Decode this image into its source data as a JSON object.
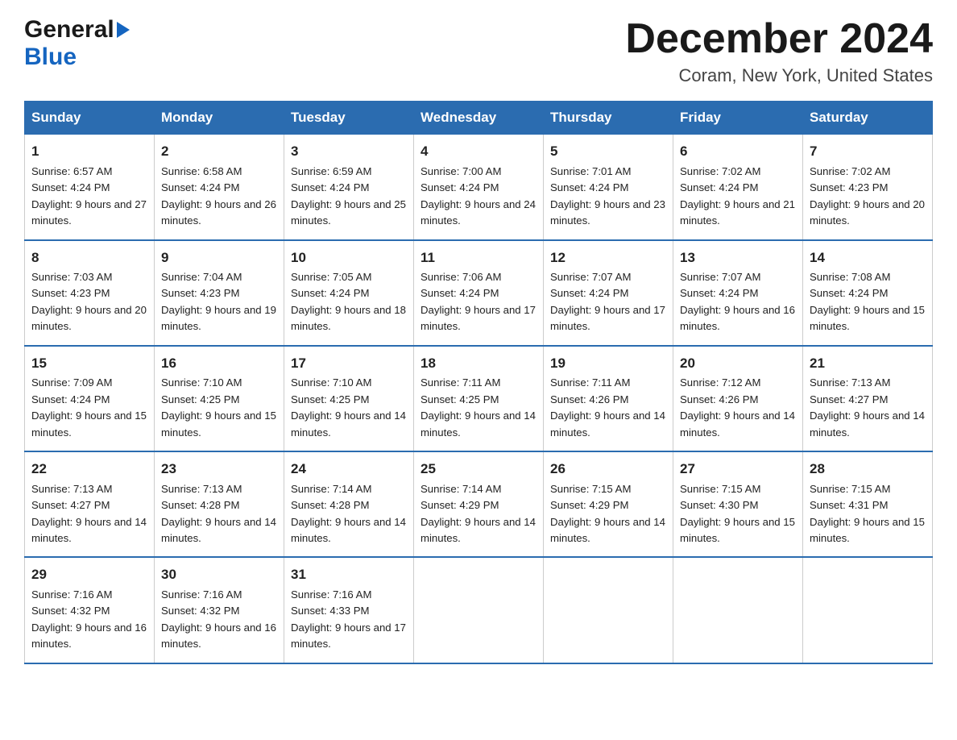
{
  "header": {
    "logo_general": "General",
    "logo_blue": "Blue",
    "title": "December 2024",
    "subtitle": "Coram, New York, United States"
  },
  "days_of_week": [
    "Sunday",
    "Monday",
    "Tuesday",
    "Wednesday",
    "Thursday",
    "Friday",
    "Saturday"
  ],
  "weeks": [
    [
      {
        "day": "1",
        "sunrise": "6:57 AM",
        "sunset": "4:24 PM",
        "daylight": "9 hours and 27 minutes."
      },
      {
        "day": "2",
        "sunrise": "6:58 AM",
        "sunset": "4:24 PM",
        "daylight": "9 hours and 26 minutes."
      },
      {
        "day": "3",
        "sunrise": "6:59 AM",
        "sunset": "4:24 PM",
        "daylight": "9 hours and 25 minutes."
      },
      {
        "day": "4",
        "sunrise": "7:00 AM",
        "sunset": "4:24 PM",
        "daylight": "9 hours and 24 minutes."
      },
      {
        "day": "5",
        "sunrise": "7:01 AM",
        "sunset": "4:24 PM",
        "daylight": "9 hours and 23 minutes."
      },
      {
        "day": "6",
        "sunrise": "7:02 AM",
        "sunset": "4:24 PM",
        "daylight": "9 hours and 21 minutes."
      },
      {
        "day": "7",
        "sunrise": "7:02 AM",
        "sunset": "4:23 PM",
        "daylight": "9 hours and 20 minutes."
      }
    ],
    [
      {
        "day": "8",
        "sunrise": "7:03 AM",
        "sunset": "4:23 PM",
        "daylight": "9 hours and 20 minutes."
      },
      {
        "day": "9",
        "sunrise": "7:04 AM",
        "sunset": "4:23 PM",
        "daylight": "9 hours and 19 minutes."
      },
      {
        "day": "10",
        "sunrise": "7:05 AM",
        "sunset": "4:24 PM",
        "daylight": "9 hours and 18 minutes."
      },
      {
        "day": "11",
        "sunrise": "7:06 AM",
        "sunset": "4:24 PM",
        "daylight": "9 hours and 17 minutes."
      },
      {
        "day": "12",
        "sunrise": "7:07 AM",
        "sunset": "4:24 PM",
        "daylight": "9 hours and 17 minutes."
      },
      {
        "day": "13",
        "sunrise": "7:07 AM",
        "sunset": "4:24 PM",
        "daylight": "9 hours and 16 minutes."
      },
      {
        "day": "14",
        "sunrise": "7:08 AM",
        "sunset": "4:24 PM",
        "daylight": "9 hours and 15 minutes."
      }
    ],
    [
      {
        "day": "15",
        "sunrise": "7:09 AM",
        "sunset": "4:24 PM",
        "daylight": "9 hours and 15 minutes."
      },
      {
        "day": "16",
        "sunrise": "7:10 AM",
        "sunset": "4:25 PM",
        "daylight": "9 hours and 15 minutes."
      },
      {
        "day": "17",
        "sunrise": "7:10 AM",
        "sunset": "4:25 PM",
        "daylight": "9 hours and 14 minutes."
      },
      {
        "day": "18",
        "sunrise": "7:11 AM",
        "sunset": "4:25 PM",
        "daylight": "9 hours and 14 minutes."
      },
      {
        "day": "19",
        "sunrise": "7:11 AM",
        "sunset": "4:26 PM",
        "daylight": "9 hours and 14 minutes."
      },
      {
        "day": "20",
        "sunrise": "7:12 AM",
        "sunset": "4:26 PM",
        "daylight": "9 hours and 14 minutes."
      },
      {
        "day": "21",
        "sunrise": "7:13 AM",
        "sunset": "4:27 PM",
        "daylight": "9 hours and 14 minutes."
      }
    ],
    [
      {
        "day": "22",
        "sunrise": "7:13 AM",
        "sunset": "4:27 PM",
        "daylight": "9 hours and 14 minutes."
      },
      {
        "day": "23",
        "sunrise": "7:13 AM",
        "sunset": "4:28 PM",
        "daylight": "9 hours and 14 minutes."
      },
      {
        "day": "24",
        "sunrise": "7:14 AM",
        "sunset": "4:28 PM",
        "daylight": "9 hours and 14 minutes."
      },
      {
        "day": "25",
        "sunrise": "7:14 AM",
        "sunset": "4:29 PM",
        "daylight": "9 hours and 14 minutes."
      },
      {
        "day": "26",
        "sunrise": "7:15 AM",
        "sunset": "4:29 PM",
        "daylight": "9 hours and 14 minutes."
      },
      {
        "day": "27",
        "sunrise": "7:15 AM",
        "sunset": "4:30 PM",
        "daylight": "9 hours and 15 minutes."
      },
      {
        "day": "28",
        "sunrise": "7:15 AM",
        "sunset": "4:31 PM",
        "daylight": "9 hours and 15 minutes."
      }
    ],
    [
      {
        "day": "29",
        "sunrise": "7:16 AM",
        "sunset": "4:32 PM",
        "daylight": "9 hours and 16 minutes."
      },
      {
        "day": "30",
        "sunrise": "7:16 AM",
        "sunset": "4:32 PM",
        "daylight": "9 hours and 16 minutes."
      },
      {
        "day": "31",
        "sunrise": "7:16 AM",
        "sunset": "4:33 PM",
        "daylight": "9 hours and 17 minutes."
      },
      null,
      null,
      null,
      null
    ]
  ],
  "labels": {
    "sunrise_prefix": "Sunrise: ",
    "sunset_prefix": "Sunset: ",
    "daylight_prefix": "Daylight: "
  }
}
